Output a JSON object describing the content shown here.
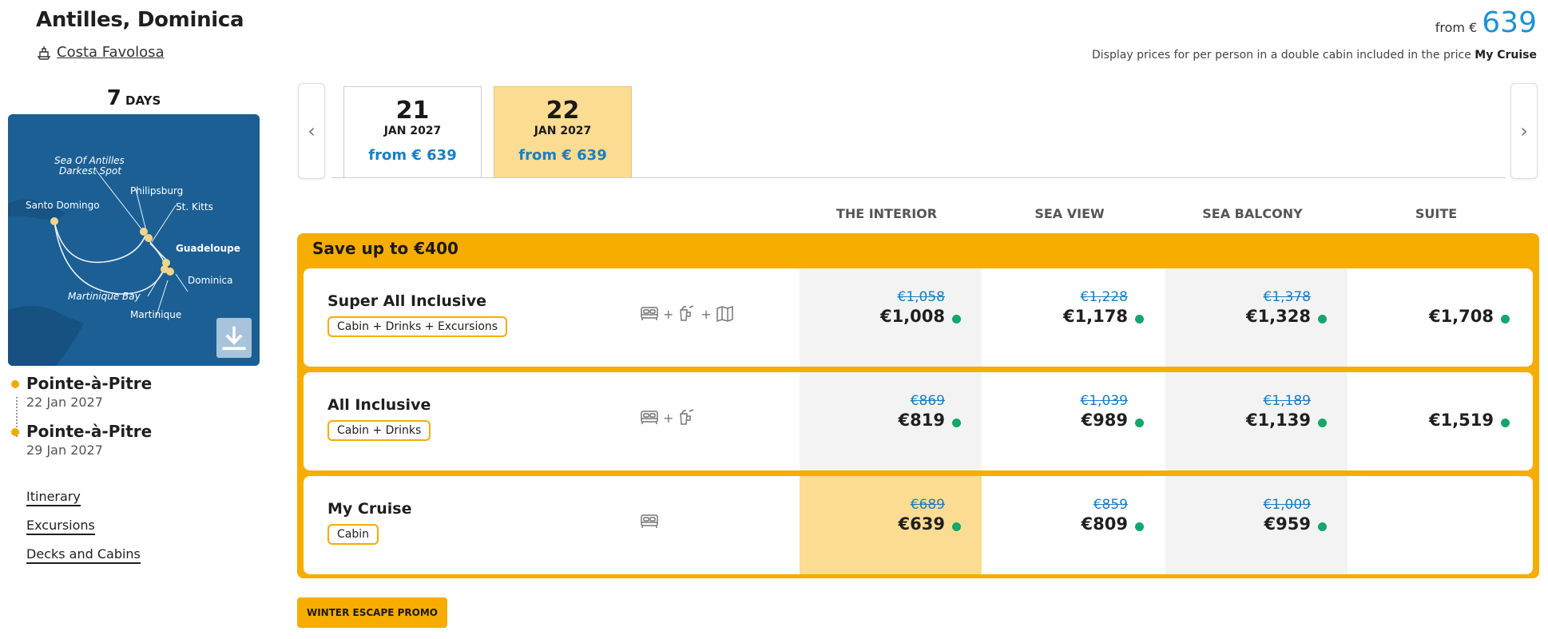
{
  "header": {
    "title": "Antilles, Dominica",
    "ship": "Costa Favolosa",
    "from_label": "from €",
    "from_price": "639",
    "note_prefix": "Display prices for per person in a double cabin included in the price ",
    "note_bold": "My Cruise"
  },
  "sidebar": {
    "days_number": "7",
    "days_label": "DAYS",
    "map": {
      "labels": [
        "Sea Of Antilles",
        "Darkest Spot",
        "Philipsburg",
        "St. Kitts",
        "Santo Domingo",
        "Guadeloupe",
        "Dominica",
        "Martinique Bay",
        "Martinique"
      ]
    },
    "ports": [
      {
        "name": "Pointe-à-Pitre",
        "date": "22 Jan 2027"
      },
      {
        "name": "Pointe-à-Pitre",
        "date": "29 Jan 2027"
      }
    ],
    "links": [
      "Itinerary",
      "Excursions",
      "Decks and Cabins"
    ]
  },
  "dates": [
    {
      "day": "21",
      "month_year": "JAN 2027",
      "from": "from € 639",
      "active": false
    },
    {
      "day": "22",
      "month_year": "JAN 2027",
      "from": "from € 639",
      "active": true
    }
  ],
  "columns": [
    "THE INTERIOR",
    "SEA VIEW",
    "SEA BALCONY",
    "SUITE"
  ],
  "promo": {
    "title": "Save up to €400",
    "rows": [
      {
        "name": "Super All Inclusive",
        "pill": "Cabin + Drinks + Excursions",
        "icons": [
          "bed-icon",
          "drinks-icon",
          "map-icon"
        ],
        "prices": [
          {
            "old": "€1,058",
            "new": "€1,008"
          },
          {
            "old": "€1,228",
            "new": "€1,178"
          },
          {
            "old": "€1,378",
            "new": "€1,328"
          },
          {
            "old": "",
            "new": "€1,708"
          }
        ]
      },
      {
        "name": "All Inclusive",
        "pill": "Cabin + Drinks",
        "icons": [
          "bed-icon",
          "drinks-icon"
        ],
        "prices": [
          {
            "old": "€869",
            "new": "€819"
          },
          {
            "old": "€1,039",
            "new": "€989"
          },
          {
            "old": "€1,189",
            "new": "€1,139"
          },
          {
            "old": "",
            "new": "€1,519"
          }
        ]
      },
      {
        "name": "My Cruise",
        "pill": "Cabin",
        "icons": [
          "bed-icon"
        ],
        "prices": [
          {
            "old": "€689",
            "new": "€639"
          },
          {
            "old": "€859",
            "new": "€809"
          },
          {
            "old": "€1,009",
            "new": "€959"
          },
          {
            "old": "",
            "new": ""
          }
        ]
      }
    ]
  },
  "badge": "WINTER ESCAPE PROMO",
  "colors": {
    "accent": "#f7ac00",
    "selected": "#fcdc92",
    "link_blue": "#1a7fc1",
    "available": "#14a66b"
  }
}
